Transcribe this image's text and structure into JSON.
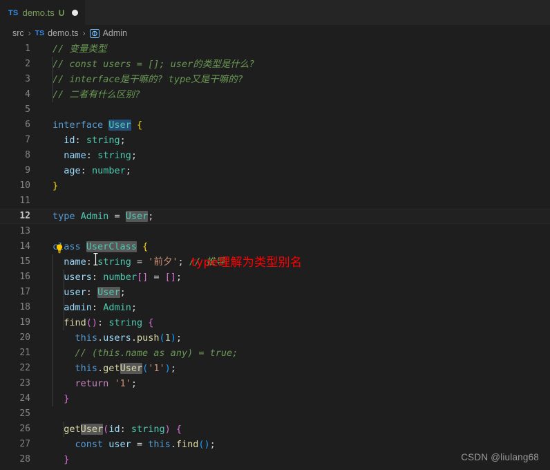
{
  "window": {
    "background": "#1e1e1e",
    "theme": "Dark+ (default dark)"
  },
  "tabbar": {
    "tab": {
      "file_type_badge": "TS",
      "title": "demo.ts",
      "git_status": "U",
      "dirty_indicator_icon": "filled-circle-icon",
      "icon_name": "typescript-file-icon"
    }
  },
  "breadcrumb": {
    "items": [
      {
        "label": "src",
        "icon": ""
      },
      {
        "label": "demo.ts",
        "icon": "typescript-file-icon"
      },
      {
        "label": "Admin",
        "icon": "interface-symbol-icon"
      }
    ],
    "separator": "›"
  },
  "editor": {
    "lightbulb_line": 11,
    "active_line": 12,
    "lines": [
      {
        "n": "1",
        "html": "<span class='c-comment'>// 变量类型</span>"
      },
      {
        "n": "2",
        "html": "<span class='c-comment'>// const users = []; user的类型是什么?</span>"
      },
      {
        "n": "3",
        "html": "<span class='c-comment'>// interface是干嘛的? type又是干嘛的?</span>"
      },
      {
        "n": "4",
        "html": "<span class='c-comment'>// 二者有什么区别?</span>"
      },
      {
        "n": "5",
        "html": ""
      },
      {
        "n": "6",
        "html": "<span class='c-key'>interface</span> <span class='c-iface hl-sel'>User</span> <span class='c-brace1'>{</span>"
      },
      {
        "n": "7",
        "html": "  <span class='c-prop'>id</span><span class='c-punc'>:</span> <span class='c-type'>string</span><span class='c-punc'>;</span>"
      },
      {
        "n": "8",
        "html": "  <span class='c-prop'>name</span><span class='c-punc'>:</span> <span class='c-type'>string</span><span class='c-punc'>;</span>"
      },
      {
        "n": "9",
        "html": "  <span class='c-prop'>age</span><span class='c-punc'>:</span> <span class='c-type'>number</span><span class='c-punc'>;</span>"
      },
      {
        "n": "10",
        "html": "<span class='c-brace1'>}</span>"
      },
      {
        "n": "11",
        "html": ""
      },
      {
        "n": "12",
        "html": "<span class='c-key'>type</span> <span class='c-type'>Admin</span> <span class='c-punc'>=</span> <span class='c-iface hl-word'>User</span><span class='c-punc'>;</span>"
      },
      {
        "n": "13",
        "html": ""
      },
      {
        "n": "14",
        "html": "<span class='c-key'>class</span> <span class='c-type hl-word'>UserClass</span> <span class='c-brace1'>{</span>"
      },
      {
        "n": "15",
        "html": "  <span class='c-prop'>name</span><span class='c-punc'>:</span> <span class='c-type'>string</span> <span class='c-punc'>=</span> <span class='c-str'>'前夕'</span><span class='c-punc'>;</span> <span class='c-comment'>// 推导</span>"
      },
      {
        "n": "16",
        "html": "  <span class='c-prop'>users</span><span class='c-punc'>:</span> <span class='c-type'>number</span><span class='c-brace2'>[]</span> <span class='c-punc'>=</span> <span class='c-brace2'>[]</span><span class='c-punc'>;</span>"
      },
      {
        "n": "17",
        "html": "  <span class='c-prop'>user</span><span class='c-punc'>:</span> <span class='c-iface hl-word'>User</span><span class='c-punc'>;</span>"
      },
      {
        "n": "18",
        "html": "  <span class='c-prop'>admin</span><span class='c-punc'>:</span> <span class='c-type'>Admin</span><span class='c-punc'>;</span>"
      },
      {
        "n": "19",
        "html": "  <span class='c-fn'>find</span><span class='c-brace2'>()</span><span class='c-punc'>:</span> <span class='c-type'>string</span> <span class='c-brace2'>{</span>"
      },
      {
        "n": "20",
        "html": "    <span class='c-this'>this</span><span class='c-punc'>.</span><span class='c-var'>users</span><span class='c-punc'>.</span><span class='c-fn'>push</span><span class='c-brace3'>(</span><span class='c-num'>1</span><span class='c-brace3'>)</span><span class='c-punc'>;</span>"
      },
      {
        "n": "21",
        "html": "    <span class='c-comment'>// (this.name as any) = true;</span>"
      },
      {
        "n": "22",
        "html": "    <span class='c-this'>this</span><span class='c-punc'>.</span><span class='c-fn'>get</span><span class='c-fn hl-word'>User</span><span class='c-brace3'>(</span><span class='c-str'>'1'</span><span class='c-brace3'>)</span><span class='c-punc'>;</span>"
      },
      {
        "n": "23",
        "html": "    <span class='c-key2'>return</span> <span class='c-str'>'1'</span><span class='c-punc'>;</span>"
      },
      {
        "n": "24",
        "html": "  <span class='c-brace2'>}</span>"
      },
      {
        "n": "25",
        "html": ""
      },
      {
        "n": "26",
        "html": "  <span class='c-fn'>get</span><span class='c-fn hl-word'>User</span><span class='c-brace2'>(</span><span class='c-prop'>id</span><span class='c-punc'>:</span> <span class='c-type'>string</span><span class='c-brace2'>)</span> <span class='c-brace2'>{</span>"
      },
      {
        "n": "27",
        "html": "    <span class='c-key'>const</span> <span class='c-var'>user</span> <span class='c-punc'>=</span> <span class='c-this'>this</span><span class='c-punc'>.</span><span class='c-fn'>find</span><span class='c-brace3'>()</span><span class='c-punc'>;</span>"
      },
      {
        "n": "28",
        "html": "  <span class='c-brace2'>}</span>"
      }
    ],
    "plain_text_lines": [
      "// 变量类型",
      "// const users = []; user的类型是什么?",
      "// interface是干嘛的? type又是干嘛的?",
      "// 二者有什么区别?",
      "",
      "interface User {",
      "  id: string;",
      "  name: string;",
      "  age: number;",
      "}",
      "",
      "type Admin = User;",
      "",
      "class UserClass {",
      "  name: string = '前夕'; // 推导",
      "  users: number[] = [];",
      "  user: User;",
      "  admin: Admin;",
      "  find(): string {",
      "    this.users.push(1);",
      "    // (this.name as any) = true;",
      "    this.getUser('1');",
      "    return '1';",
      "  }",
      "",
      "  getUser(id: string) {",
      "    const user = this.find();",
      "  }"
    ]
  },
  "annotation": {
    "text": "type理解为类型别名",
    "color": "#ff0000"
  },
  "cursor": {
    "icon": "text-ibeam-cursor",
    "line": 12,
    "over_token": "Admin"
  },
  "watermark": {
    "text": "CSDN @liulang68"
  },
  "colors": {
    "editor_background": "#1e1e1e",
    "tabbar_background": "#252526",
    "line_number": "#858585",
    "active_line_number": "#c6c6c6",
    "comment": "#6a9955",
    "keyword": "#569cd6",
    "type": "#4ec9b0",
    "string": "#ce9178",
    "function": "#dcdcaa",
    "selection_highlight": "#264f78",
    "word_highlight": "#575757",
    "annotation_red": "#ff0000"
  }
}
